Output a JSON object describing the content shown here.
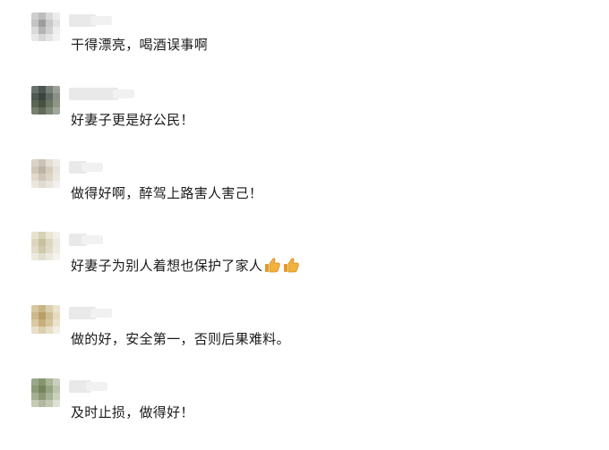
{
  "comments": [
    {
      "text": "干得漂亮，喝酒误事啊",
      "emoji": []
    },
    {
      "text": "好妻子更是好公民！",
      "emoji": []
    },
    {
      "text": "做得好啊，醉驾上路害人害己！",
      "emoji": []
    },
    {
      "text": "好妻子为别人着想也保护了家人",
      "emoji": [
        "thumbs-up-icon",
        "thumbs-up-icon"
      ]
    },
    {
      "text": "做的好，安全第一，否则后果难料。",
      "emoji": []
    },
    {
      "text": "及时止损，做得好！",
      "emoji": []
    }
  ],
  "colors": {
    "background": "#ffffff",
    "text": "#1a1a1a",
    "thumb": "#f2b33d"
  }
}
